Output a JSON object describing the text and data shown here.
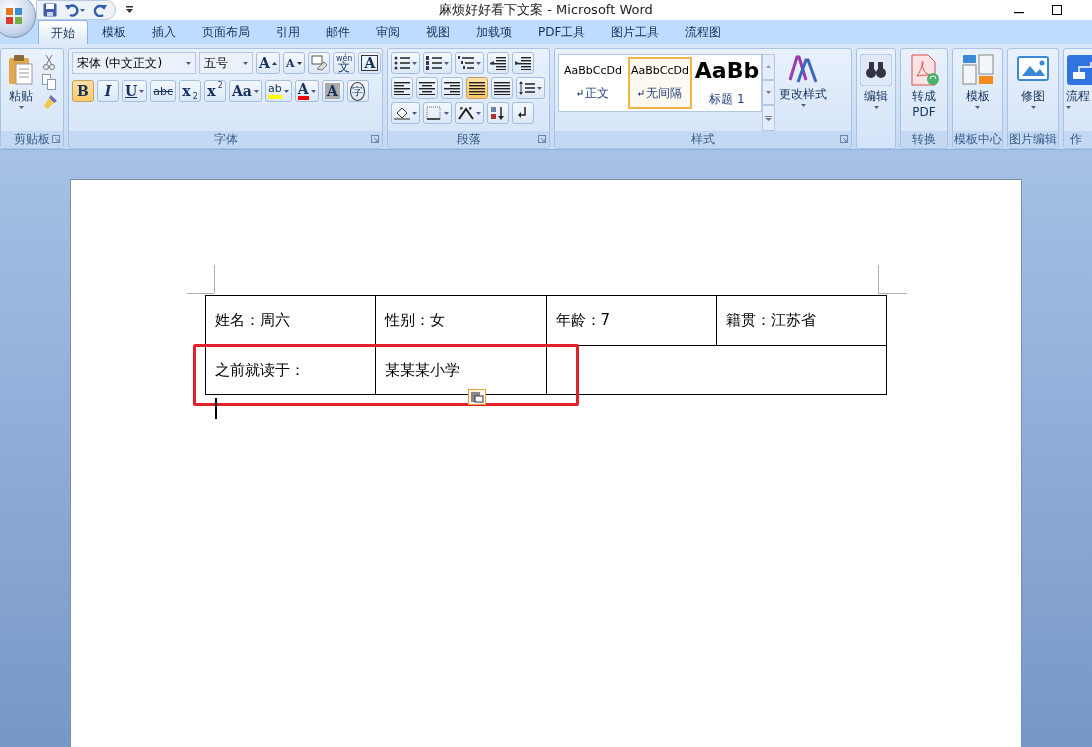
{
  "window": {
    "title": "麻烦好好看下文案 - Microsoft Word"
  },
  "tabs": [
    {
      "label": "开始",
      "selected": true
    },
    {
      "label": "模板",
      "selected": false
    },
    {
      "label": "插入",
      "selected": false
    },
    {
      "label": "页面布局",
      "selected": false
    },
    {
      "label": "引用",
      "selected": false
    },
    {
      "label": "邮件",
      "selected": false
    },
    {
      "label": "审阅",
      "selected": false
    },
    {
      "label": "视图",
      "selected": false
    },
    {
      "label": "加载项",
      "selected": false
    },
    {
      "label": "PDF工具",
      "selected": false
    },
    {
      "label": "图片工具",
      "selected": false
    },
    {
      "label": "流程图",
      "selected": false
    }
  ],
  "ribbon": {
    "groups": [
      {
        "kind": "clipboard",
        "label": "剪贴板",
        "paste": "粘贴"
      },
      {
        "kind": "font",
        "label": "字体",
        "font_name": "宋体 (中文正文)",
        "font_size": "五号",
        "row1": [
          {
            "kind": "grow",
            "label": "A"
          },
          {
            "kind": "shrink",
            "label": "A"
          },
          {
            "kind": "clear"
          },
          {
            "kind": "phonetic",
            "label": "文",
            "sub": "wén"
          },
          {
            "kind": "border",
            "label": "A"
          }
        ],
        "row2": [
          {
            "kind": "bold",
            "label": "B",
            "on": true
          },
          {
            "kind": "italic",
            "label": "I",
            "on": false
          },
          {
            "kind": "underline",
            "label": "U",
            "on": false
          },
          {
            "kind": "strike",
            "label": "abc",
            "on": false
          },
          {
            "kind": "subscript",
            "label": "x",
            "sub": "2",
            "on": false
          },
          {
            "kind": "superscript",
            "label": "x",
            "sup": "2",
            "on": false
          },
          {
            "kind": "case",
            "label": "Aa",
            "on": false
          },
          {
            "kind": "highlight",
            "label": "ab",
            "on": false
          },
          {
            "kind": "fontcolor",
            "label": "A",
            "on": false
          },
          {
            "kind": "shade",
            "label": "A",
            "on": false
          },
          {
            "kind": "enclose",
            "label": "字",
            "on": false
          }
        ]
      },
      {
        "kind": "paragraph",
        "label": "段落",
        "alignments": [
          {
            "selected": false
          },
          {
            "selected": false
          },
          {
            "selected": false
          },
          {
            "selected": true
          },
          {
            "selected": false
          }
        ]
      },
      {
        "kind": "styles",
        "label": "样式",
        "styles": [
          {
            "preview": "AaBbCcDd",
            "name": "正文",
            "selected": false
          },
          {
            "preview": "AaBbCcDd",
            "name": "无间隔",
            "selected": true
          },
          {
            "preview": "AaBb",
            "name": "标题 1",
            "selected": false
          }
        ],
        "change": "更改样式"
      },
      {
        "kind": "big",
        "button": [
          "编辑"
        ]
      },
      {
        "kind": "big",
        "button": [
          "转成",
          "PDF"
        ],
        "label": "转换"
      },
      {
        "kind": "big",
        "button": [
          "模板"
        ],
        "label": "模板中心"
      },
      {
        "kind": "big",
        "button": [
          "修图"
        ],
        "label": "图片编辑"
      },
      {
        "kind": "big",
        "button": [
          "流程"
        ],
        "label": "作"
      }
    ]
  },
  "document": {
    "table": {
      "rows": [
        [
          {
            "text": "姓名：周六"
          },
          {
            "text": "性别：女"
          },
          {
            "text": "年龄：7"
          },
          {
            "text": "籍贯：江苏省"
          }
        ],
        [
          {
            "text": "之前就读于："
          },
          {
            "text": "某某某小学"
          },
          {
            "wide": true
          }
        ]
      ]
    }
  }
}
